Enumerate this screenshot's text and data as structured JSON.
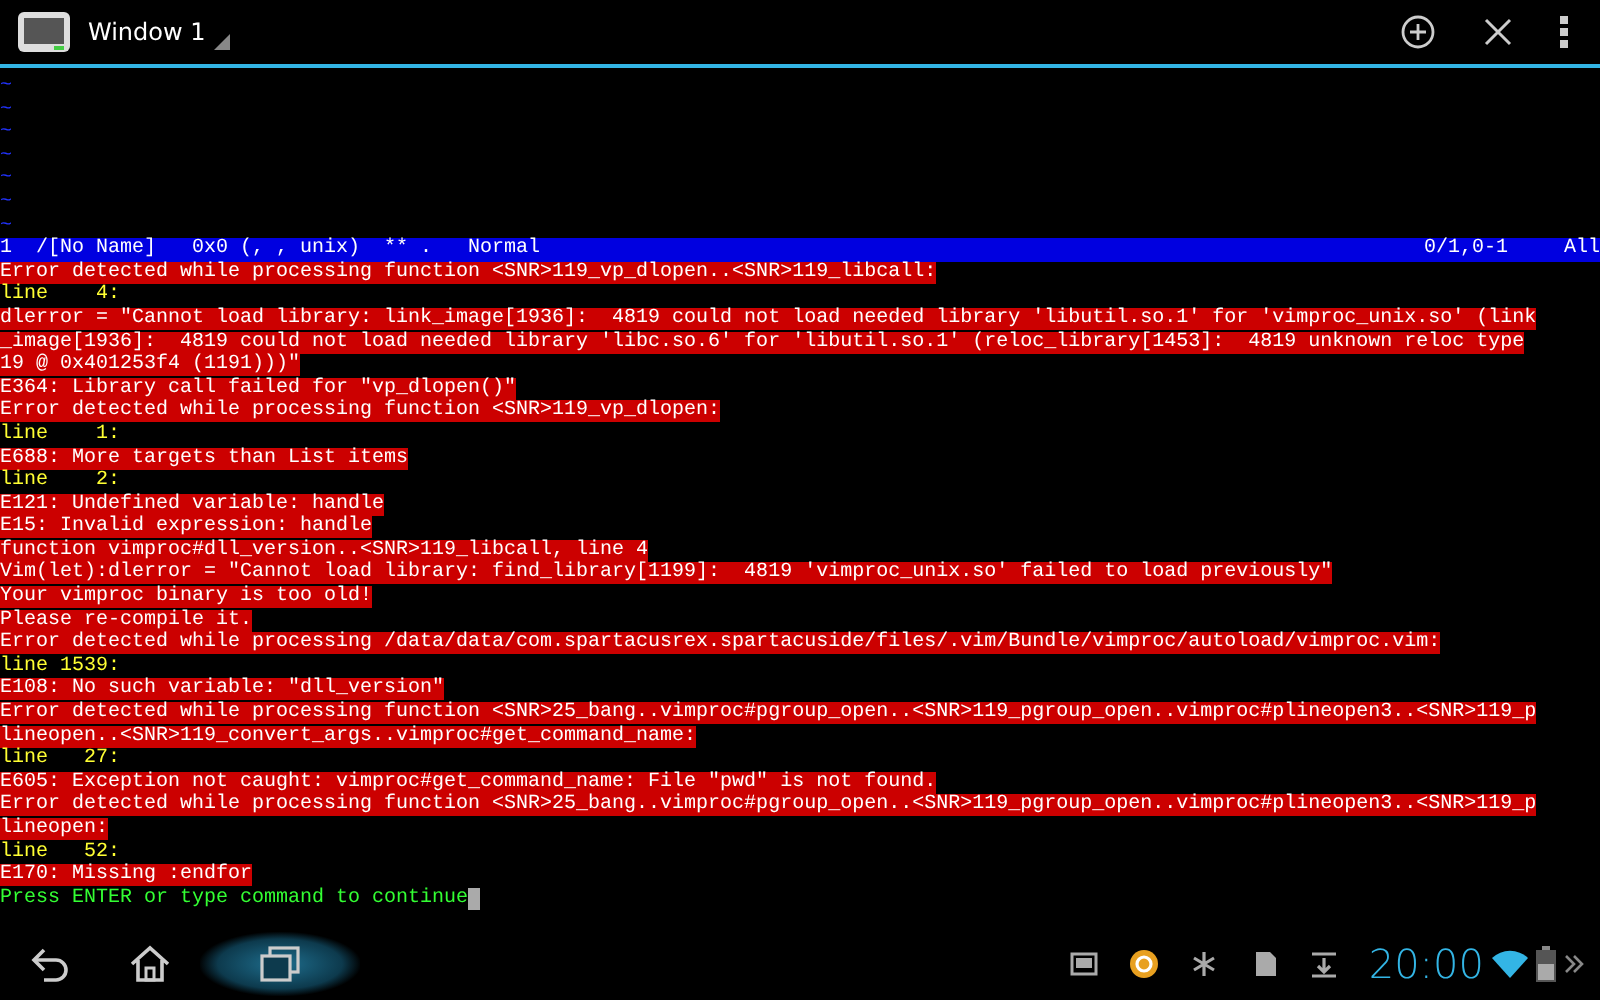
{
  "app_bar": {
    "title": "Window 1"
  },
  "vim": {
    "tilde_rows": [
      "~",
      "~",
      "~",
      "~",
      "~",
      "~",
      "~"
    ],
    "status_line": {
      "left": "1  /[No Name]   0x0 (, , unix)  ** .   Normal",
      "position": "0/1,0-1",
      "scroll": "All"
    },
    "messages": [
      {
        "kind": "error",
        "text": "Error detected while processing function <SNR>119_vp_dlopen..<SNR>119_libcall:"
      },
      {
        "kind": "linenr",
        "text": "line    4:"
      },
      {
        "kind": "error",
        "text": "dlerror = \"Cannot load library: link_image[1936]:  4819 could not load needed library 'libutil.so.1' for 'vimproc_unix.so' (link"
      },
      {
        "kind": "error",
        "text": "_image[1936]:  4819 could not load needed library 'libc.so.6' for 'libutil.so.1' (reloc_library[1453]:  4819 unknown reloc type"
      },
      {
        "kind": "error",
        "text": "19 @ 0x401253f4 (1191)))\""
      },
      {
        "kind": "error",
        "text": "E364: Library call failed for \"vp_dlopen()\""
      },
      {
        "kind": "error",
        "text": "Error detected while processing function <SNR>119_vp_dlopen:"
      },
      {
        "kind": "linenr",
        "text": "line    1:"
      },
      {
        "kind": "error",
        "text": "E688: More targets than List items"
      },
      {
        "kind": "linenr",
        "text": "line    2:"
      },
      {
        "kind": "error",
        "text": "E121: Undefined variable: handle"
      },
      {
        "kind": "error",
        "text": "E15: Invalid expression: handle"
      },
      {
        "kind": "error",
        "text": "function vimproc#dll_version..<SNR>119_libcall, line 4"
      },
      {
        "kind": "error",
        "text": "Vim(let):dlerror = \"Cannot load library: find_library[1199]:  4819 'vimproc_unix.so' failed to load previously\""
      },
      {
        "kind": "error",
        "text": "Your vimproc binary is too old!"
      },
      {
        "kind": "error",
        "text": "Please re-compile it."
      },
      {
        "kind": "error",
        "text": "Error detected while processing /data/data/com.spartacusrex.spartacuside/files/.vim/Bundle/vimproc/autoload/vimproc.vim:"
      },
      {
        "kind": "linenr",
        "text": "line 1539:"
      },
      {
        "kind": "error",
        "text": "E108: No such variable: \"dll_version\""
      },
      {
        "kind": "error",
        "text": "Error detected while processing function <SNR>25_bang..vimproc#pgroup_open..<SNR>119_pgroup_open..vimproc#plineopen3..<SNR>119_p"
      },
      {
        "kind": "error",
        "text": "lineopen..<SNR>119_convert_args..vimproc#get_command_name:"
      },
      {
        "kind": "linenr",
        "text": "line   27:"
      },
      {
        "kind": "error",
        "text": "E605: Exception not caught: vimproc#get_command_name: File \"pwd\" is not found."
      },
      {
        "kind": "error",
        "text": "Error detected while processing function <SNR>25_bang..vimproc#pgroup_open..<SNR>119_pgroup_open..vimproc#plineopen3..<SNR>119_p"
      },
      {
        "kind": "error",
        "text": "lineopen:"
      },
      {
        "kind": "linenr",
        "text": "line   52:"
      },
      {
        "kind": "error",
        "text": "E170: Missing :endfor"
      }
    ],
    "prompt": {
      "text": "Press ENTER or type command to continue"
    }
  },
  "system_bar": {
    "clock": "20:00"
  }
}
